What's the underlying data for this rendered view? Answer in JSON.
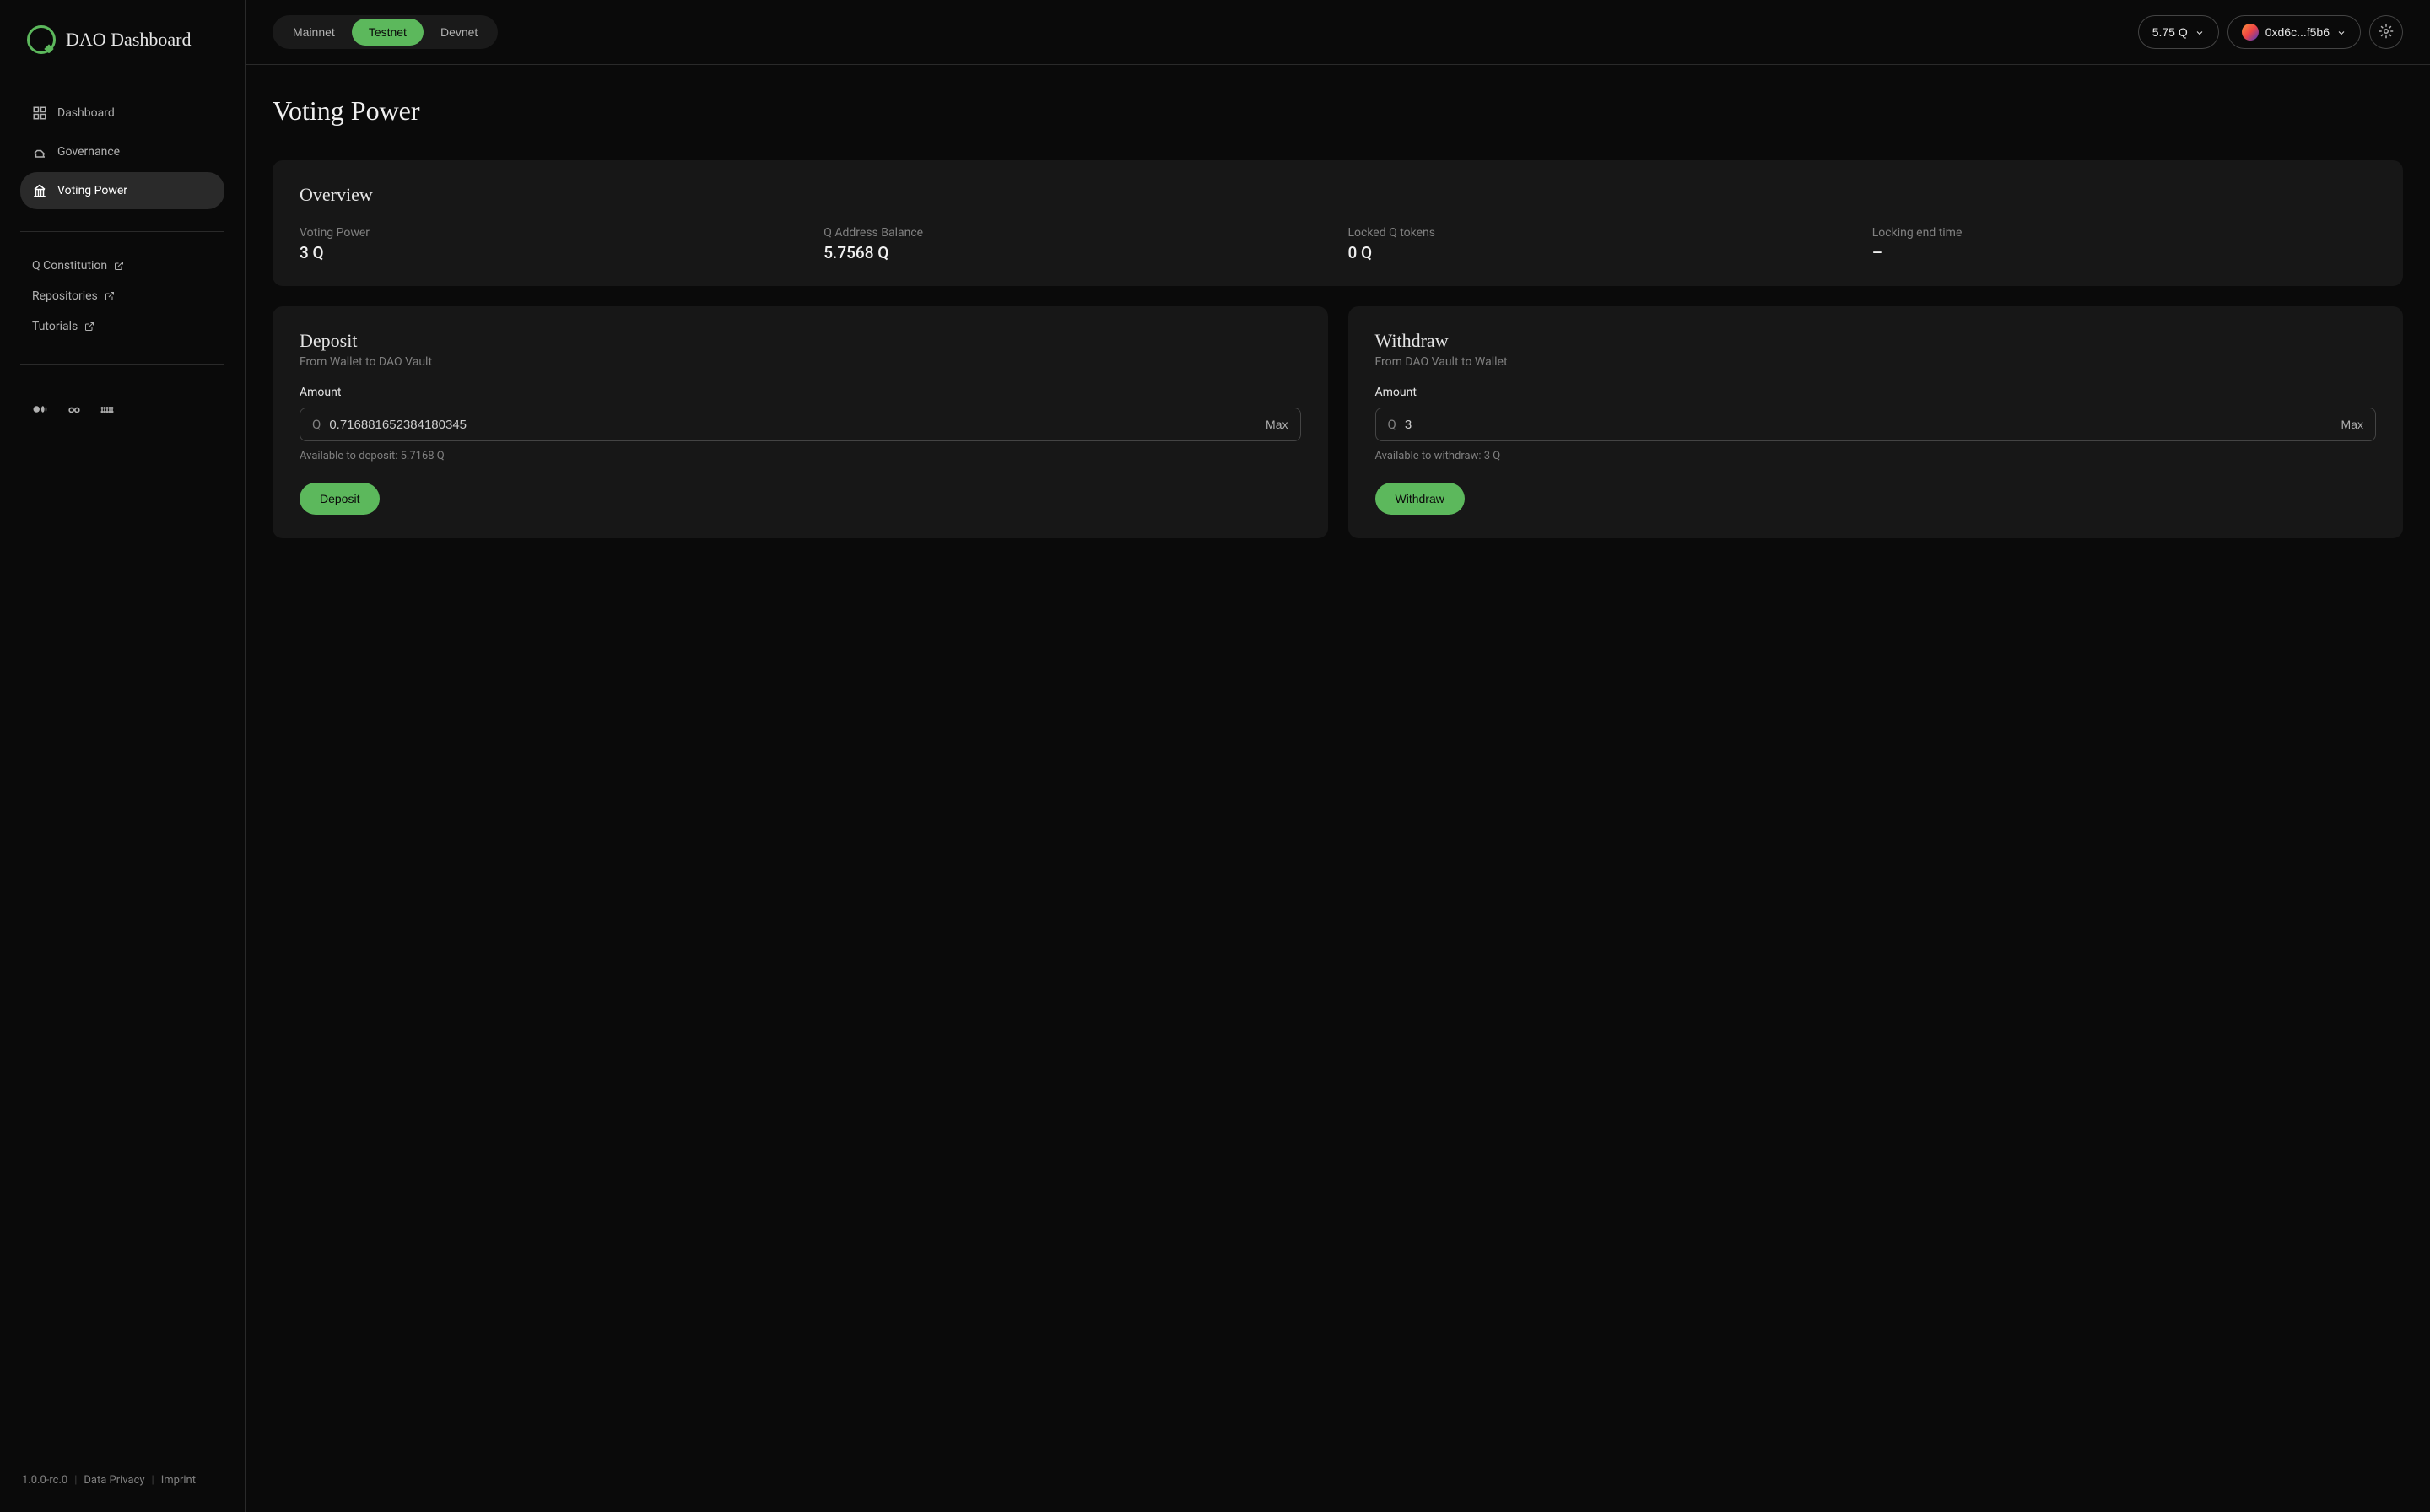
{
  "app": {
    "title": "DAO Dashboard"
  },
  "sidebar": {
    "nav": [
      {
        "label": "Dashboard",
        "icon": "dashboard"
      },
      {
        "label": "Governance",
        "icon": "governance"
      },
      {
        "label": "Voting Power",
        "icon": "voting-power",
        "active": true
      }
    ],
    "links": [
      {
        "label": "Q Constitution"
      },
      {
        "label": "Repositories"
      },
      {
        "label": "Tutorials"
      }
    ],
    "footer": {
      "version": "1.0.0-rc.0",
      "privacy": "Data Privacy",
      "imprint": "Imprint"
    }
  },
  "header": {
    "networks": [
      {
        "label": "Mainnet"
      },
      {
        "label": "Testnet",
        "active": true
      },
      {
        "label": "Devnet"
      }
    ],
    "balance": "5.75 Q",
    "wallet": "0xd6c...f5b6"
  },
  "page": {
    "title": "Voting Power"
  },
  "overview": {
    "title": "Overview",
    "stats": [
      {
        "label": "Voting Power",
        "value": "3 Q"
      },
      {
        "label": "Q Address Balance",
        "value": "5.7568 Q"
      },
      {
        "label": "Locked Q tokens",
        "value": "0 Q"
      },
      {
        "label": "Locking end time",
        "value": "–"
      }
    ]
  },
  "deposit": {
    "title": "Deposit",
    "subtitle": "From Wallet to DAO Vault",
    "amount_label": "Amount",
    "prefix": "Q",
    "value": "0.716881652384180345",
    "max": "Max",
    "helper": "Available to deposit: 5.7168 Q",
    "button": "Deposit"
  },
  "withdraw": {
    "title": "Withdraw",
    "subtitle": "From DAO Vault to Wallet",
    "amount_label": "Amount",
    "prefix": "Q",
    "value": "3",
    "max": "Max",
    "helper": "Available to withdraw: 3 Q",
    "button": "Withdraw"
  }
}
